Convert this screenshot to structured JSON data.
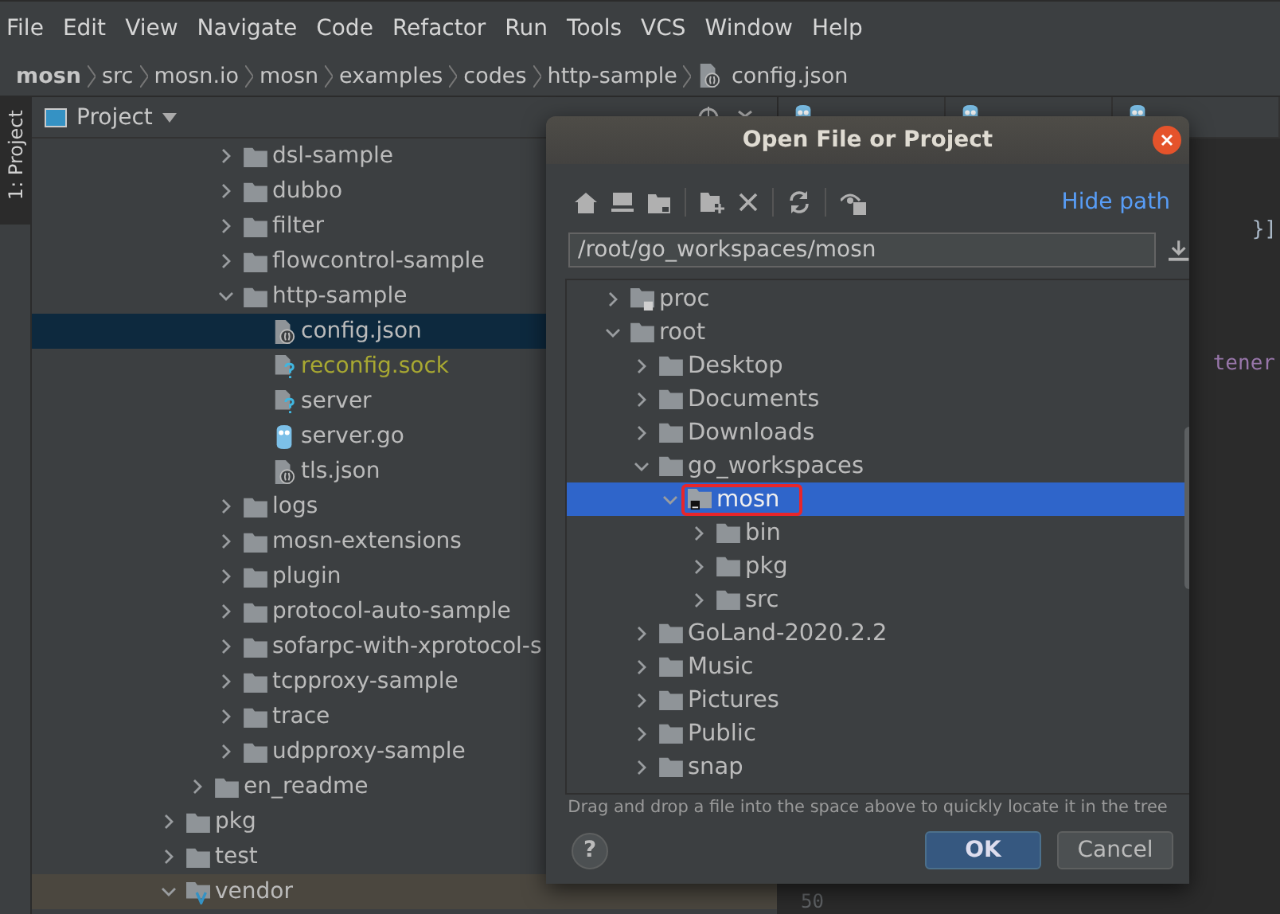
{
  "menu": [
    "File",
    "Edit",
    "View",
    "Navigate",
    "Code",
    "Refactor",
    "Run",
    "Tools",
    "VCS",
    "Window",
    "Help"
  ],
  "breadcrumb": [
    {
      "label": "mosn",
      "kind": "root"
    },
    {
      "label": "src",
      "kind": "folder"
    },
    {
      "label": "mosn.io",
      "kind": "folder"
    },
    {
      "label": "mosn",
      "kind": "folder"
    },
    {
      "label": "examples",
      "kind": "folder"
    },
    {
      "label": "codes",
      "kind": "folder"
    },
    {
      "label": "http-sample",
      "kind": "folder"
    },
    {
      "label": "config.json",
      "kind": "json"
    }
  ],
  "side_stripe": {
    "label": "1: Project"
  },
  "project": {
    "title": "Project",
    "tree": [
      {
        "children": [
          {
            "children": [
              {
                "label": "dsl-sample",
                "kind": "folder",
                "expanded": false,
                "selected": false,
                "ignored": false,
                "hovered": false
              },
              {
                "label": "dubbo",
                "kind": "folder",
                "expanded": false,
                "selected": false,
                "ignored": false,
                "hovered": false
              },
              {
                "label": "filter",
                "kind": "folder",
                "expanded": false,
                "selected": false,
                "ignored": false,
                "hovered": false
              },
              {
                "label": "flowcontrol-sample",
                "kind": "folder",
                "expanded": false,
                "selected": false,
                "ignored": false,
                "hovered": false
              },
              {
                "label": "http-sample",
                "kind": "folder",
                "expanded": true,
                "selected": false,
                "ignored": false,
                "hovered": false,
                "children": [
                  {
                    "label": "config.json",
                    "kind": "json",
                    "selected": true,
                    "ignored": false,
                    "hovered": false
                  },
                  {
                    "label": "reconfig.sock",
                    "kind": "unknown",
                    "selected": false,
                    "ignored": true,
                    "hovered": false
                  },
                  {
                    "label": "server",
                    "kind": "unknown",
                    "selected": false,
                    "ignored": false,
                    "hovered": false
                  },
                  {
                    "label": "server.go",
                    "kind": "go",
                    "selected": false,
                    "ignored": false,
                    "hovered": false
                  },
                  {
                    "label": "tls.json",
                    "kind": "json",
                    "selected": false,
                    "ignored": false,
                    "hovered": false
                  }
                ]
              },
              {
                "label": "logs",
                "kind": "folder",
                "expanded": false,
                "selected": false,
                "ignored": false,
                "hovered": false
              },
              {
                "label": "mosn-extensions",
                "kind": "folder",
                "expanded": false,
                "selected": false,
                "ignored": false,
                "hovered": false
              },
              {
                "label": "plugin",
                "kind": "folder",
                "expanded": false,
                "selected": false,
                "ignored": false,
                "hovered": false
              },
              {
                "label": "protocol-auto-sample",
                "kind": "folder",
                "expanded": false,
                "selected": false,
                "ignored": false,
                "hovered": false
              },
              {
                "label": "sofarpc-with-xprotocol-s",
                "kind": "folder",
                "expanded": false,
                "selected": false,
                "ignored": false,
                "hovered": false
              },
              {
                "label": "tcpproxy-sample",
                "kind": "folder",
                "expanded": false,
                "selected": false,
                "ignored": false,
                "hovered": false
              },
              {
                "label": "trace",
                "kind": "folder",
                "expanded": false,
                "selected": false,
                "ignored": false,
                "hovered": false
              },
              {
                "label": "udpproxy-sample",
                "kind": "folder",
                "expanded": false,
                "selected": false,
                "ignored": false,
                "hovered": false
              }
            ]
          },
          {
            "label": "en_readme",
            "kind": "folder",
            "expanded": false,
            "selected": false,
            "ignored": false,
            "hovered": false
          }
        ]
      },
      {
        "label": "pkg",
        "kind": "folder",
        "expanded": false,
        "selected": false,
        "ignored": false,
        "hovered": false
      },
      {
        "label": "test",
        "kind": "folder",
        "expanded": false,
        "selected": false,
        "ignored": false,
        "hovered": false
      },
      {
        "label": "vendor",
        "kind": "vendor",
        "expanded": true,
        "selected": false,
        "ignored": false,
        "hovered": true
      }
    ]
  },
  "editor": {
    "tabs": [
      {
        "kind": "go"
      },
      {
        "kind": "go"
      },
      {
        "kind": "go"
      }
    ],
    "lines": [
      {
        "text": "}]",
        "kind": "plain"
      },
      {
        "text": "tener",
        "kind": "key"
      }
    ],
    "line_number": "50"
  },
  "dialog": {
    "title": "Open File or Project",
    "marker_box": true,
    "hide_path": "Hide path",
    "path": "/root/go_workspaces/mosn",
    "tree": [
      {
        "label": "proc",
        "kind": "locked",
        "expanded": false,
        "selected": false
      },
      {
        "label": "root",
        "kind": "folder",
        "expanded": true,
        "selected": false,
        "children": [
          {
            "label": "Desktop",
            "kind": "folder",
            "expanded": false,
            "selected": false
          },
          {
            "label": "Documents",
            "kind": "folder",
            "expanded": false,
            "selected": false
          },
          {
            "label": "Downloads",
            "kind": "folder",
            "expanded": false,
            "selected": false
          },
          {
            "label": "go_workspaces",
            "kind": "folder",
            "expanded": true,
            "selected": false,
            "children": [
              {
                "label": "mosn",
                "kind": "project",
                "expanded": true,
                "selected": true,
                "children": [
                  {
                    "label": "bin",
                    "kind": "folder",
                    "expanded": false,
                    "selected": false
                  },
                  {
                    "label": "pkg",
                    "kind": "folder",
                    "expanded": false,
                    "selected": false
                  },
                  {
                    "label": "src",
                    "kind": "folder",
                    "expanded": false,
                    "selected": false
                  }
                ]
              }
            ]
          },
          {
            "label": "GoLand-2020.2.2",
            "kind": "folder",
            "expanded": false,
            "selected": false
          },
          {
            "label": "Music",
            "kind": "folder",
            "expanded": false,
            "selected": false
          },
          {
            "label": "Pictures",
            "kind": "folder",
            "expanded": false,
            "selected": false
          },
          {
            "label": "Public",
            "kind": "folder",
            "expanded": false,
            "selected": false
          },
          {
            "label": "snap",
            "kind": "folder",
            "expanded": false,
            "selected": false
          }
        ]
      }
    ],
    "hint": "Drag and drop a file into the space above to quickly locate it in the tree",
    "help": "?",
    "buttons": [
      {
        "label": "OK",
        "kind": "default"
      },
      {
        "label": "Cancel",
        "kind": "normal"
      }
    ]
  }
}
